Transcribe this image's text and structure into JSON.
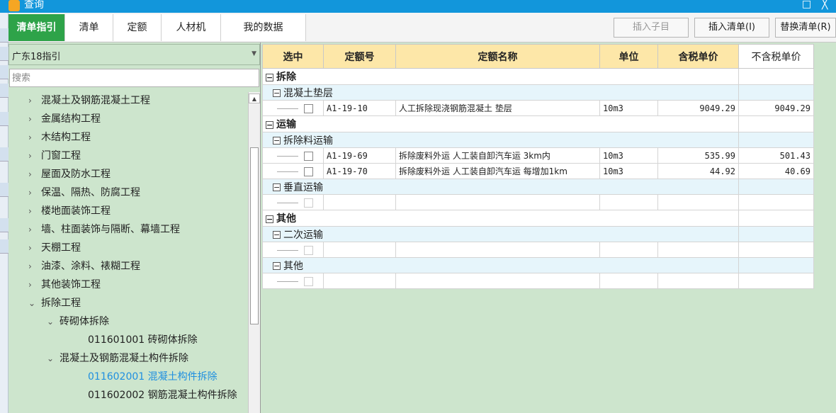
{
  "window": {
    "title": "查询",
    "restore_glyph": "□",
    "close_glyph": "╳"
  },
  "tabs": [
    {
      "label": "清单指引",
      "active": true
    },
    {
      "label": "清单"
    },
    {
      "label": "定额"
    },
    {
      "label": "人材机"
    },
    {
      "label": "我的数据"
    }
  ],
  "toolbar": {
    "insert_child": "插入子目",
    "insert_list": "插入清单(I)",
    "replace_list": "替换清单(R)"
  },
  "left": {
    "guide_select": "广东18指引",
    "search_placeholder": "搜索",
    "tree": [
      {
        "text": "混凝土及钢筋混凝土工程",
        "toggle": "›"
      },
      {
        "text": "金属结构工程",
        "toggle": "›"
      },
      {
        "text": "木结构工程",
        "toggle": "›"
      },
      {
        "text": "门窗工程",
        "toggle": "›"
      },
      {
        "text": "屋面及防水工程",
        "toggle": "›"
      },
      {
        "text": "保温、隔热、防腐工程",
        "toggle": "›"
      },
      {
        "text": "楼地面装饰工程",
        "toggle": "›"
      },
      {
        "text": "墙、柱面装饰与隔断、幕墙工程",
        "toggle": "›"
      },
      {
        "text": "天棚工程",
        "toggle": "›"
      },
      {
        "text": "油漆、涂料、裱糊工程",
        "toggle": "›"
      },
      {
        "text": "其他装饰工程",
        "toggle": "›"
      },
      {
        "text": "拆除工程",
        "toggle": "⌄"
      },
      {
        "text": "砖砌体拆除",
        "toggle": "⌄"
      },
      {
        "text": "011601001  砖砌体拆除",
        "toggle": ""
      },
      {
        "text": "混凝土及钢筋混凝土构件拆除",
        "toggle": "⌄"
      },
      {
        "text": "011602001  混凝土构件拆除",
        "toggle": "",
        "selected": true
      },
      {
        "text": "011602002  钢筋混凝土构件拆除",
        "toggle": ""
      }
    ]
  },
  "grid": {
    "headers": [
      "选中",
      "定额号",
      "定额名称",
      "单位",
      "含税单价",
      "不含税单价"
    ],
    "groups": [
      {
        "label": "拆除",
        "subgroups": [
          {
            "label": "混凝土垫层",
            "rows": [
              {
                "code": "A1-19-10",
                "name": "人工拆除现浇钢筋混凝土 垫层",
                "unit": "10m3",
                "price_tax": "9049.29",
                "price_notax": "9049.29"
              }
            ]
          }
        ]
      },
      {
        "label": "运输",
        "subgroups": [
          {
            "label": "拆除料运输",
            "rows": [
              {
                "code": "A1-19-69",
                "name": "拆除废料外运 人工装自卸汽车运 3km内",
                "unit": "10m3",
                "price_tax": "535.99",
                "price_notax": "501.43"
              },
              {
                "code": "A1-19-70",
                "name": "拆除废料外运 人工装自卸汽车运 每增加1km",
                "unit": "10m3",
                "price_tax": "44.92",
                "price_notax": "40.69"
              }
            ]
          },
          {
            "label": "垂直运输",
            "rows": []
          }
        ]
      },
      {
        "label": "其他",
        "subgroups": [
          {
            "label": "二次运输",
            "rows": []
          },
          {
            "label": "其他",
            "rows": []
          }
        ]
      }
    ]
  }
}
